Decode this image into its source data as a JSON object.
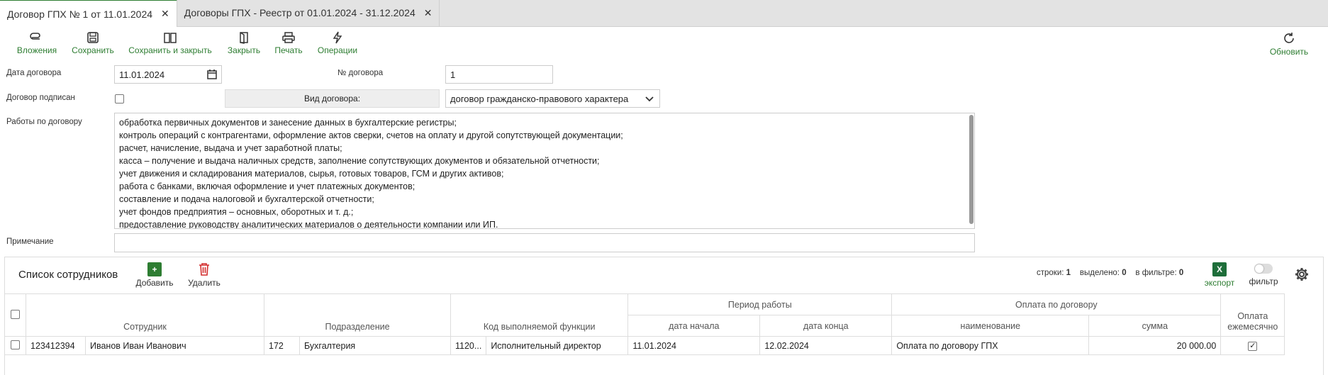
{
  "tabs": [
    {
      "label": "Договор ГПХ № 1 от 11.01.2024"
    },
    {
      "label": "Договоры ГПХ - Реестр от 01.01.2024 - 31.12.2024"
    }
  ],
  "toolbar": {
    "attachments": "Вложения",
    "save": "Сохранить",
    "save_close": "Сохранить и закрыть",
    "close": "Закрыть",
    "print": "Печать",
    "operations": "Операции",
    "refresh": "Обновить"
  },
  "form": {
    "date_label": "Дата договора",
    "date_value": "11.01.2024",
    "number_label": "№ договора",
    "number_value": "1",
    "signed_label": "Договор подписан",
    "type_button": "Вид договора:",
    "type_value": "договор гражданско-правового характера",
    "works_label": "Работы по договору",
    "works_lines": [
      "обработка первичных документов и занесение данных в бухгалтерские регистры;",
      "контроль операций с контрагентами, оформление актов сверки, счетов на оплату и другой сопутствующей документации;",
      "расчет, начисление, выдача и учет заработной платы;",
      "касса – получение и выдача наличных средств, заполнение сопутствующих документов и обязательной отчетности;",
      "учет движения и складирования материалов, сырья, готовых товаров, ГСМ и других активов;",
      "работа с банками, включая оформление и учет платежных документов;",
      "составление и подача налоговой и бухгалтерской отчетности;",
      "учет фондов предприятия – основных, оборотных и т. д.;",
      "предоставление руководству аналитических материалов о деятельности компании или ИП."
    ],
    "note_label": "Примечание",
    "note_value": ""
  },
  "employees": {
    "title": "Список сотрудников",
    "add": "Добавить",
    "delete": "Удалить",
    "rows_label": "строки:",
    "rows_value": "1",
    "selected_label": "выделено:",
    "selected_value": "0",
    "filter_count_label": "в фильтре:",
    "filter_count_value": "0",
    "export": "экспорт",
    "filter": "фильтр",
    "headers": {
      "employee": "Сотрудник",
      "department": "Подразделение",
      "function_code": "Код выполняемой функции",
      "period": "Период работы",
      "date_start": "дата начала",
      "date_end": "дата конца",
      "payment": "Оплата по договору",
      "name": "наименование",
      "sum": "сумма",
      "monthly": "Оплата ежемесячно"
    },
    "rows": [
      {
        "id": "123412394",
        "name": "Иванов Иван Иванович",
        "dep_code": "172",
        "dep_name": "Бухгалтерия",
        "func_code": "1120...",
        "func_name": "Исполнительный директор",
        "date_start": "11.01.2024",
        "date_end": "12.02.2024",
        "payment_name": "Оплата по договору ГПХ",
        "sum": "20 000.00"
      }
    ]
  },
  "colors": {
    "accent": "#2e7d32",
    "delete": "#d32f2f",
    "excel": "#1e6e3a"
  }
}
